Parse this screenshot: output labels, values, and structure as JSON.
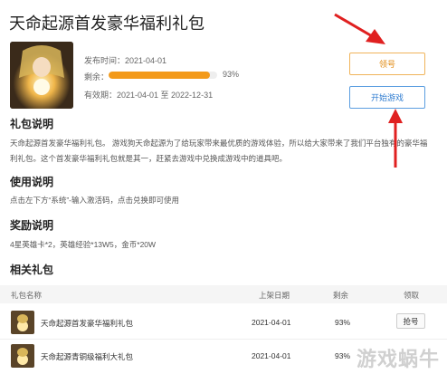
{
  "page": {
    "title": "天命起源首发豪华福利礼包"
  },
  "gift": {
    "release_label": "发布时间：2021-04-01",
    "remain_label": "剩余：",
    "remain_percent": 93,
    "remain_text": "93%",
    "valid_label": "有效期：2021-04-01 至 2022-12-31",
    "claim_button": "领号",
    "play_button": "开始游戏"
  },
  "sections": {
    "desc_title": "礼包说明",
    "desc_line1": "天命起源首发豪华福利礼包。 游戏狗天命起源为了给玩家带来最优质的游戏体验，所以给大家带来了我们平台独有的豪华福",
    "desc_line2": "利礼包。这个首发豪华福利礼包就是其一，赶紧去游戏中兑换成游戏中的道具吧。",
    "usage_title": "使用说明",
    "usage_text": "点击左下方“系统”-输入激活码，点击兑换即可使用",
    "reward_title": "奖励说明",
    "reward_text": "4星英雄卡*2，英雄经验*13W5，金币*20W",
    "related_title": "相关礼包"
  },
  "table": {
    "headers": {
      "name": "礼包名称",
      "date": "上架日期",
      "remain": "剩余",
      "action": "领取"
    },
    "rows": [
      {
        "name": "天命起源首发豪华福利礼包",
        "date": "2021-04-01",
        "remain": "93%",
        "action": "抢号"
      },
      {
        "name": "天命起源青铜级福利大礼包",
        "date": "2021-04-01",
        "remain": "93%",
        "action": ""
      }
    ]
  },
  "watermark": "游戏蜗牛",
  "colors": {
    "accent_orange": "#f39a1a",
    "accent_blue": "#2f7cd0",
    "annotation_red": "#e02020"
  }
}
